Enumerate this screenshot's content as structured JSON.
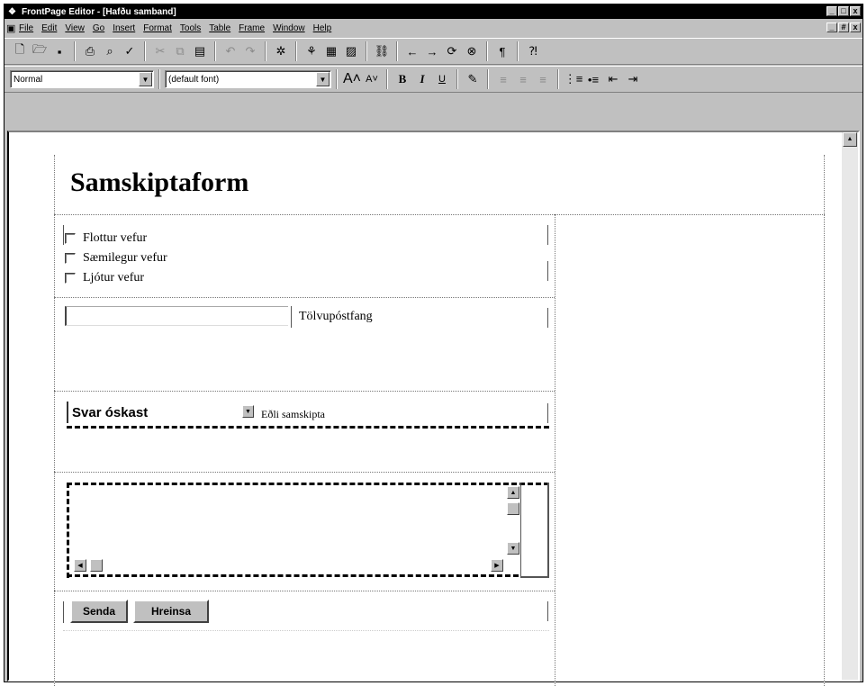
{
  "window": {
    "title": "FrontPage Editor - [Hafðu samband]",
    "controls": [
      "_",
      "□",
      "x"
    ],
    "mdi_controls": [
      "_",
      "#",
      "x"
    ]
  },
  "menu": {
    "items": [
      "File",
      "Edit",
      "View",
      "Go",
      "Insert",
      "Format",
      "Tools",
      "Table",
      "Frame",
      "Window",
      "Help"
    ]
  },
  "toolbar1": {
    "icons": [
      "new-icon",
      "open-icon",
      "save-icon",
      "print-icon",
      "print-preview-icon",
      "spelling-icon",
      "cut-icon",
      "copy-icon",
      "paste-icon",
      "undo-icon",
      "redo-icon",
      "webbot-icon",
      "form-field-icon",
      "table-icon",
      "image-icon",
      "link-icon",
      "back-icon",
      "forward-icon",
      "refresh-icon",
      "stop-icon",
      "paragraph-icon",
      "help-icon"
    ]
  },
  "toolbar2": {
    "style_value": "Normal",
    "font_value": "(default font)",
    "bold_label": "B",
    "italic_label": "I",
    "underline_label": "U"
  },
  "document": {
    "heading": "Samskiptaform",
    "checkboxes": [
      {
        "label": "Flottur vefur"
      },
      {
        "label": "Sæmilegur vefur"
      },
      {
        "label": "Ljótur vefur"
      }
    ],
    "email_label": "Tölvupóstfang",
    "email_value": "",
    "select_value": "Svar óskast",
    "select_label": "Eðli samskipta",
    "textarea_value": "",
    "submit_label": "Senda",
    "reset_label": "Hreinsa"
  }
}
